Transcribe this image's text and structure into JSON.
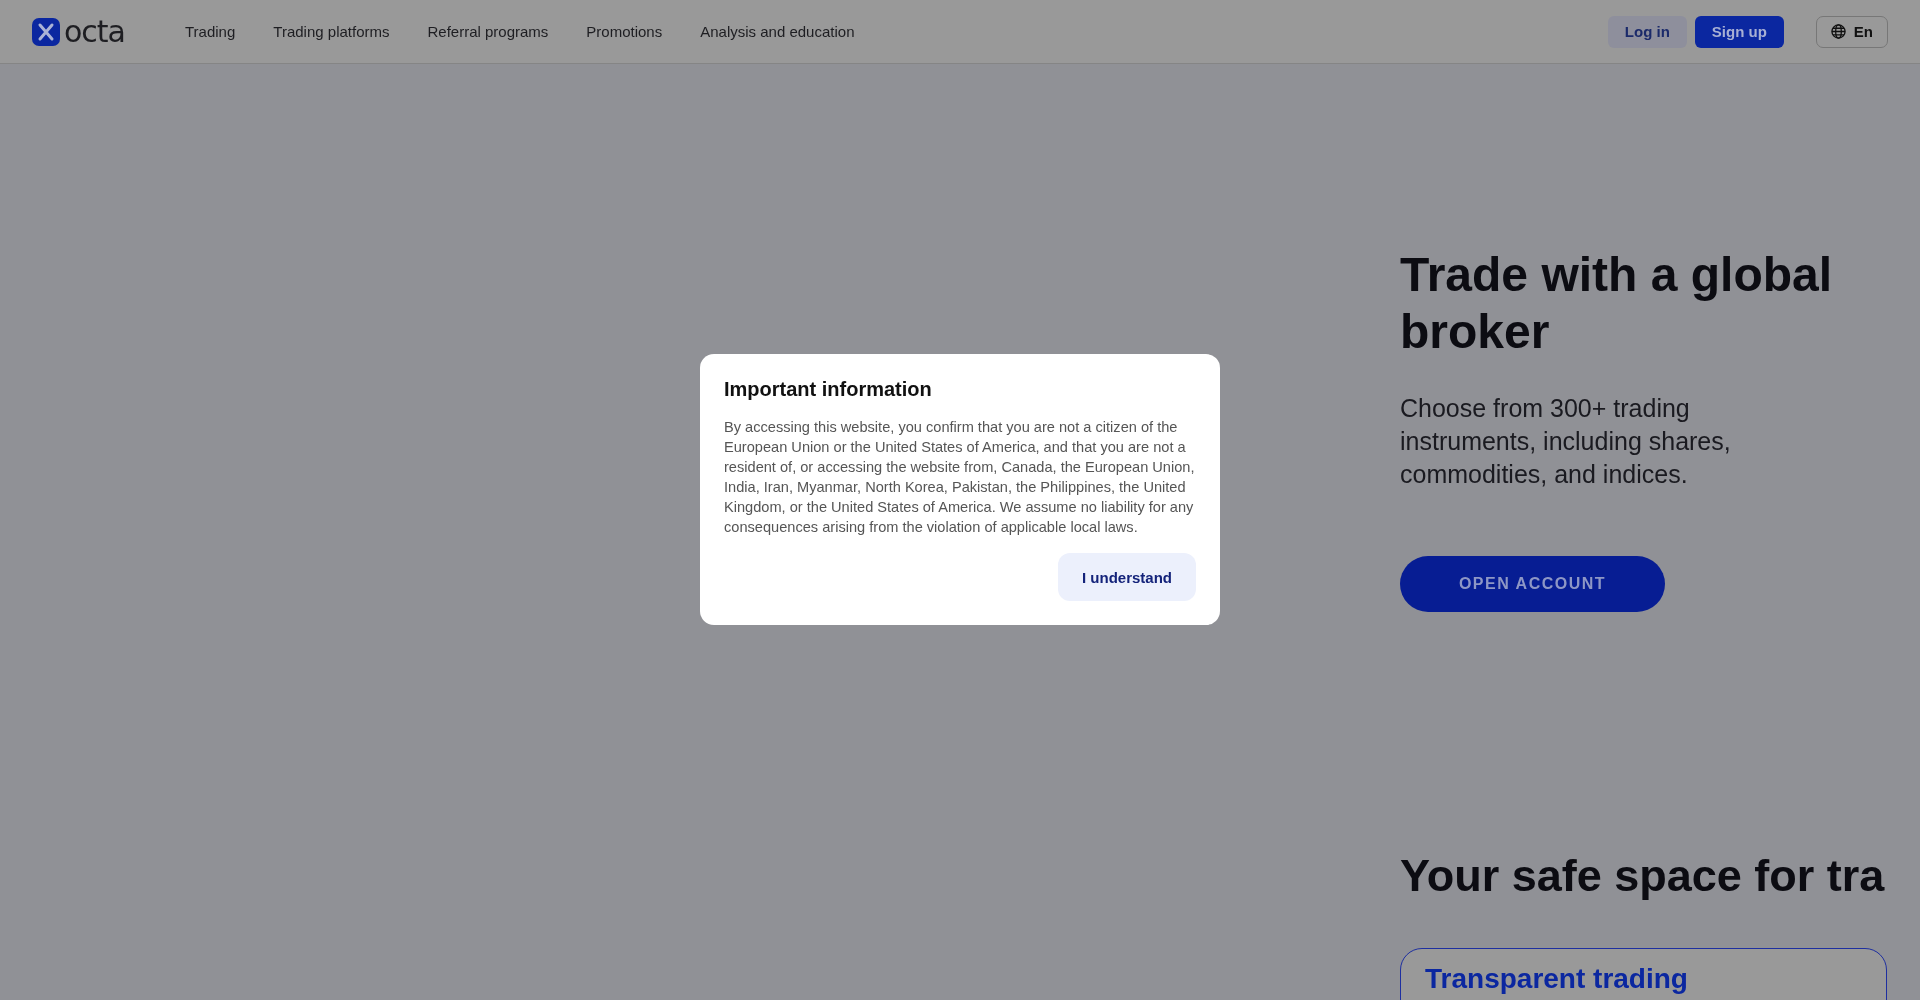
{
  "header": {
    "logo": "octa",
    "nav": [
      {
        "label": "Trading"
      },
      {
        "label": "Trading platforms"
      },
      {
        "label": "Referral programs"
      },
      {
        "label": "Promotions"
      },
      {
        "label": "Analysis and education"
      }
    ],
    "actions": [
      {
        "label": "Log in",
        "kind": "secondary"
      },
      {
        "label": "Sign up",
        "kind": "primary"
      }
    ],
    "language": "En"
  },
  "hero": {
    "title": "Trade with a global broker",
    "subtitle": "Choose from 300+ trading instruments, including shares, commodities, and indices.",
    "cta": "OPEN ACCOUNT"
  },
  "section": {
    "heading": "Your safe space for tra",
    "card_title": "Transparent trading"
  },
  "dialog": {
    "title": "Important information",
    "body": "By accessing this website, you confirm that you are not a citizen of the European Union or the United States of America, and that you are not a resident of, or accessing the website from, Canada, the European Union, India, Iran, Myanmar, North Korea, Pakistan, the Philippines, the United Kingdom, or the United States of America. We assume no liability for any consequences arising from the violation of applicable local laws.",
    "button": "I understand"
  }
}
